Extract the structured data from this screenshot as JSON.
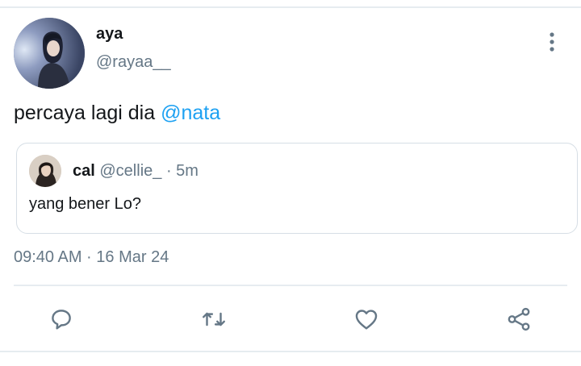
{
  "tweet": {
    "author": {
      "display_name": "aya",
      "handle": "@rayaa__"
    },
    "text": "percaya lagi dia ",
    "mention": "@nata",
    "timestamp": "09:40 AM · 16 Mar 24"
  },
  "quoted_tweet": {
    "author": {
      "display_name": "cal",
      "handle": "@cellie_"
    },
    "meta": " · 5m",
    "text": "yang bener Lo?"
  },
  "actions": {
    "icons": [
      "reply-icon",
      "retweet-icon",
      "like-icon",
      "share-icon",
      "more-icon"
    ]
  },
  "colors": {
    "accent": "#1da1f2",
    "secondary_text": "#657786",
    "icon": "#657786",
    "border": "#e6ecf0"
  }
}
